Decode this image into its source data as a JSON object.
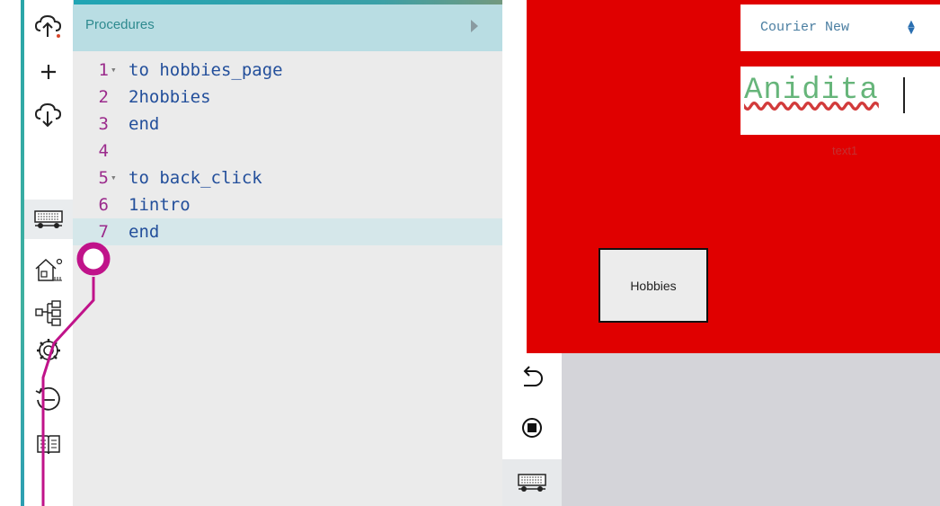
{
  "sidebar": {
    "items": [
      {
        "icon": "cloud-upload-icon"
      },
      {
        "icon": "plus-icon"
      },
      {
        "icon": "cloud-download-icon"
      },
      {
        "icon": "turtle-cart-icon",
        "selected": true
      },
      {
        "icon": "home-scene-icon"
      },
      {
        "icon": "tree-structure-icon"
      },
      {
        "icon": "gear-icon"
      },
      {
        "icon": "history-icon"
      },
      {
        "icon": "book-icon"
      }
    ]
  },
  "editor": {
    "title": "Procedures",
    "lines": [
      {
        "num": "1",
        "fold": true,
        "text": "to hobbies_page"
      },
      {
        "num": "2",
        "fold": false,
        "text": "2hobbies"
      },
      {
        "num": "3",
        "fold": false,
        "text": "end"
      },
      {
        "num": "4",
        "fold": false,
        "text": ""
      },
      {
        "num": "5",
        "fold": true,
        "text": "to back_click"
      },
      {
        "num": "6",
        "fold": false,
        "text": "1intro"
      },
      {
        "num": "7",
        "fold": false,
        "text": "end",
        "active": true
      }
    ]
  },
  "stage": {
    "font_select": {
      "value": "Courier New"
    },
    "text_box": {
      "value": "Anidita",
      "label": "text1"
    },
    "hobbies_button": {
      "label": "Hobbies"
    }
  },
  "controls": [
    {
      "icon": "undo-icon"
    },
    {
      "icon": "stop-icon"
    },
    {
      "icon": "turtle-cart-icon"
    }
  ],
  "colors": {
    "stage_background": "#e00000",
    "editor_header": "#b9dde3",
    "pointer": "#c0138a"
  }
}
